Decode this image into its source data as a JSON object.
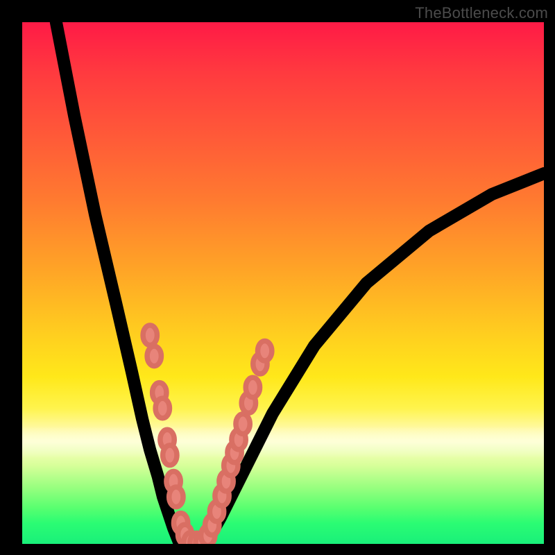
{
  "watermark": "TheBottleneck.com",
  "chart_data": {
    "type": "line",
    "title": "",
    "xlabel": "",
    "ylabel": "",
    "xlim": [
      0,
      100
    ],
    "ylim": [
      0,
      100
    ],
    "background_gradient": {
      "orientation": "vertical",
      "stops": [
        {
          "pos": 0,
          "color": "#ff1a46"
        },
        {
          "pos": 50,
          "color": "#ffa626"
        },
        {
          "pos": 75,
          "color": "#fff44d"
        },
        {
          "pos": 100,
          "color": "#19f07a"
        }
      ]
    },
    "series": [
      {
        "name": "left_branch",
        "x": [
          6.5,
          10,
          14,
          18,
          21,
          23,
          24.5,
          26,
          27,
          28,
          29,
          30
        ],
        "y": [
          100,
          82,
          63,
          46,
          33,
          24,
          18,
          13,
          9,
          6,
          3,
          0.5
        ]
      },
      {
        "name": "valley_floor",
        "x": [
          30,
          31,
          32.5,
          34,
          35.5
        ],
        "y": [
          0.5,
          0.1,
          0,
          0.1,
          0.6
        ]
      },
      {
        "name": "right_branch",
        "x": [
          35.5,
          38,
          42,
          48,
          56,
          66,
          78,
          90,
          100
        ],
        "y": [
          0.6,
          5,
          13,
          25,
          38,
          50,
          60,
          67,
          71
        ]
      }
    ],
    "markers": {
      "name": "highlighted_points",
      "color": "#e8847a",
      "points": [
        {
          "x": 24.5,
          "y": 40
        },
        {
          "x": 25.3,
          "y": 36
        },
        {
          "x": 26.3,
          "y": 29
        },
        {
          "x": 26.9,
          "y": 26
        },
        {
          "x": 27.8,
          "y": 20
        },
        {
          "x": 28.3,
          "y": 17
        },
        {
          "x": 29.0,
          "y": 12
        },
        {
          "x": 29.5,
          "y": 9
        },
        {
          "x": 30.4,
          "y": 4
        },
        {
          "x": 31.2,
          "y": 1.8
        },
        {
          "x": 32.3,
          "y": 0.3
        },
        {
          "x": 33.5,
          "y": 0.2
        },
        {
          "x": 34.6,
          "y": 0.3
        },
        {
          "x": 35.6,
          "y": 1.6
        },
        {
          "x": 36.4,
          "y": 3.6
        },
        {
          "x": 37.3,
          "y": 6.2
        },
        {
          "x": 38.3,
          "y": 9.2
        },
        {
          "x": 39.1,
          "y": 12
        },
        {
          "x": 40.0,
          "y": 15
        },
        {
          "x": 40.7,
          "y": 17.5
        },
        {
          "x": 41.5,
          "y": 20
        },
        {
          "x": 42.3,
          "y": 23
        },
        {
          "x": 43.4,
          "y": 27
        },
        {
          "x": 44.2,
          "y": 30
        },
        {
          "x": 45.6,
          "y": 34.5
        },
        {
          "x": 46.5,
          "y": 37
        }
      ]
    }
  }
}
